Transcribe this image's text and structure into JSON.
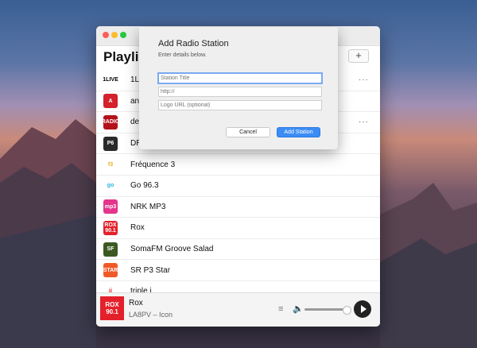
{
  "app": {
    "title": "Playlist",
    "add_label": "+"
  },
  "stations": [
    {
      "name": "1LIVE",
      "logo_text": "1LIVE",
      "logo_bg": "#ffffff",
      "logo_color": "#000000",
      "has_more": true
    },
    {
      "name": "antenne",
      "logo_text": "A",
      "logo_bg": "#d4212b",
      "logo_color": "#ffffff",
      "has_more": false
    },
    {
      "name": "delta",
      "logo_text": "RADIO",
      "logo_bg": "#b3121b",
      "logo_color": "#ffffff",
      "has_more": true
    },
    {
      "name": "DR P6",
      "logo_text": "P6",
      "logo_bg": "#2a2a2a",
      "logo_color": "#ffffff",
      "has_more": false
    },
    {
      "name": "Fréquence 3",
      "logo_text": "f3",
      "logo_bg": "#ffffff",
      "logo_color": "#e3b21b",
      "has_more": false
    },
    {
      "name": "Go 96.3",
      "logo_text": "go",
      "logo_bg": "#ffffff",
      "logo_color": "#27b5e0",
      "has_more": false
    },
    {
      "name": "NRK MP3",
      "logo_text": "mp3",
      "logo_bg": "#e4348b",
      "logo_color": "#ffffff",
      "has_more": false
    },
    {
      "name": "Rox",
      "logo_text": "ROX 90.1",
      "logo_bg": "#e4202a",
      "logo_color": "#ffffff",
      "has_more": false
    },
    {
      "name": "SomaFM Groove Salad",
      "logo_text": "SF",
      "logo_bg": "#3a5a22",
      "logo_color": "#ffffff",
      "has_more": false
    },
    {
      "name": "SR P3 Star",
      "logo_text": "STAR",
      "logo_bg": "#f05a28",
      "logo_color": "#ffffff",
      "has_more": false
    },
    {
      "name": "triple j",
      "logo_text": "jj",
      "logo_bg": "#ffffff",
      "logo_color": "#e4202a",
      "has_more": false
    }
  ],
  "player": {
    "art_text": "ROX 90.1",
    "title": "Rox",
    "subtitle": "LA8PV – Icon",
    "volume": 1.0
  },
  "dialog": {
    "title": "Add Radio Station",
    "hint": "Enter details below.",
    "title_placeholder": "Station Title",
    "url_placeholder": "http://",
    "logo_placeholder": "Logo URL (optional)",
    "cancel_label": "Cancel",
    "add_label": "Add Station"
  }
}
